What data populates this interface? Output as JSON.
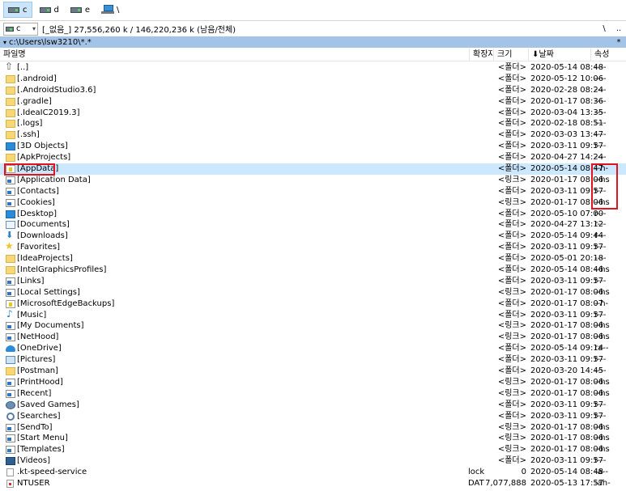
{
  "drives": [
    {
      "label": "c",
      "active": true
    },
    {
      "label": "d",
      "active": false
    },
    {
      "label": "e",
      "active": false
    },
    {
      "label": "\\",
      "active": false
    }
  ],
  "pathbar": {
    "drive_selector": "c",
    "free_info": "[_없음_]  27,556,260 k / 146,220,236 k (남음/전체)",
    "root_button": "\\",
    "parent_button": ".."
  },
  "current_path": {
    "path": "c:\\Users\\lsw3210\\*.*",
    "history_button": "*",
    "arrow_button": "▾"
  },
  "columns": {
    "name": "파일명",
    "ext": "확장자",
    "size": "크기",
    "date": "⬇날짜",
    "attr": "속성"
  },
  "files": [
    {
      "icon": "up",
      "name": "[..]",
      "ext": "",
      "size": "<폴더>",
      "date": "2020-05-14 08:48",
      "attr": "----"
    },
    {
      "icon": "folder",
      "name": "[.android]",
      "ext": "",
      "size": "<폴더>",
      "date": "2020-05-12 10:06",
      "attr": "----"
    },
    {
      "icon": "folder",
      "name": "[.AndroidStudio3.6]",
      "ext": "",
      "size": "<폴더>",
      "date": "2020-02-28 08:24",
      "attr": "----"
    },
    {
      "icon": "folder",
      "name": "[.gradle]",
      "ext": "",
      "size": "<폴더>",
      "date": "2020-01-17 08:36",
      "attr": "----"
    },
    {
      "icon": "folder",
      "name": "[.IdeaIC2019.3]",
      "ext": "",
      "size": "<폴더>",
      "date": "2020-03-04 13:35",
      "attr": "----"
    },
    {
      "icon": "folder",
      "name": "[.logs]",
      "ext": "",
      "size": "<폴더>",
      "date": "2020-02-18 08:51",
      "attr": "----"
    },
    {
      "icon": "folder",
      "name": "[.ssh]",
      "ext": "",
      "size": "<폴더>",
      "date": "2020-03-03 13:47",
      "attr": "----"
    },
    {
      "icon": "blue",
      "name": "[3D Objects]",
      "ext": "",
      "size": "<폴더>",
      "date": "2020-03-11 09:57",
      "attr": "r---"
    },
    {
      "icon": "folder",
      "name": "[ApkProjects]",
      "ext": "",
      "size": "<폴더>",
      "date": "2020-04-27 14:24",
      "attr": "----"
    },
    {
      "icon": "sys",
      "name": "[AppData]",
      "ext": "",
      "size": "<폴더>",
      "date": "2020-05-14 08:47",
      "attr": "--h-",
      "selected": true
    },
    {
      "icon": "link",
      "name": "[Application Data]",
      "ext": "",
      "size": "<링크>",
      "date": "2020-01-17 08:06",
      "attr": "--hs"
    },
    {
      "icon": "link",
      "name": "[Contacts]",
      "ext": "",
      "size": "<폴더>",
      "date": "2020-03-11 09:57",
      "attr": "r---"
    },
    {
      "icon": "link",
      "name": "[Cookies]",
      "ext": "",
      "size": "<링크>",
      "date": "2020-01-17 08:06",
      "attr": "--hs"
    },
    {
      "icon": "blue",
      "name": "[Desktop]",
      "ext": "",
      "size": "<폴더>",
      "date": "2020-05-10 07:00",
      "attr": "r---"
    },
    {
      "icon": "doc",
      "name": "[Documents]",
      "ext": "",
      "size": "<폴더>",
      "date": "2020-04-27 13:12",
      "attr": "r---"
    },
    {
      "icon": "down",
      "name": "[Downloads]",
      "ext": "",
      "size": "<폴더>",
      "date": "2020-05-14 09:44",
      "attr": "r---"
    },
    {
      "icon": "star",
      "name": "[Favorites]",
      "ext": "",
      "size": "<폴더>",
      "date": "2020-03-11 09:57",
      "attr": "r---"
    },
    {
      "icon": "folder",
      "name": "[IdeaProjects]",
      "ext": "",
      "size": "<폴더>",
      "date": "2020-05-01 20:18",
      "attr": "----"
    },
    {
      "icon": "folder",
      "name": "[IntelGraphicsProfiles]",
      "ext": "",
      "size": "<폴더>",
      "date": "2020-05-14 08:46",
      "attr": "--hs"
    },
    {
      "icon": "link",
      "name": "[Links]",
      "ext": "",
      "size": "<폴더>",
      "date": "2020-03-11 09:57",
      "attr": "r---"
    },
    {
      "icon": "link",
      "name": "[Local Settings]",
      "ext": "",
      "size": "<링크>",
      "date": "2020-01-17 08:06",
      "attr": "--hs"
    },
    {
      "icon": "sys",
      "name": "[MicrosoftEdgeBackups]",
      "ext": "",
      "size": "<폴더>",
      "date": "2020-01-17 08:07",
      "attr": "--h-"
    },
    {
      "icon": "music",
      "name": "[Music]",
      "ext": "",
      "size": "<폴더>",
      "date": "2020-03-11 09:57",
      "attr": "r---"
    },
    {
      "icon": "link",
      "name": "[My Documents]",
      "ext": "",
      "size": "<링크>",
      "date": "2020-01-17 08:06",
      "attr": "--hs"
    },
    {
      "icon": "link",
      "name": "[NetHood]",
      "ext": "",
      "size": "<링크>",
      "date": "2020-01-17 08:06",
      "attr": "--hs"
    },
    {
      "icon": "cloud",
      "name": "[OneDrive]",
      "ext": "",
      "size": "<폴더>",
      "date": "2020-05-14 09:14",
      "attr": "ra--"
    },
    {
      "icon": "pic",
      "name": "[Pictures]",
      "ext": "",
      "size": "<폴더>",
      "date": "2020-03-11 09:57",
      "attr": "r---"
    },
    {
      "icon": "folder",
      "name": "[Postman]",
      "ext": "",
      "size": "<폴더>",
      "date": "2020-03-20 14:45",
      "attr": "----"
    },
    {
      "icon": "link",
      "name": "[PrintHood]",
      "ext": "",
      "size": "<링크>",
      "date": "2020-01-17 08:06",
      "attr": "--hs"
    },
    {
      "icon": "link",
      "name": "[Recent]",
      "ext": "",
      "size": "<링크>",
      "date": "2020-01-17 08:06",
      "attr": "--hs"
    },
    {
      "icon": "game",
      "name": "[Saved Games]",
      "ext": "",
      "size": "<폴더>",
      "date": "2020-03-11 09:57",
      "attr": "r---"
    },
    {
      "icon": "search",
      "name": "[Searches]",
      "ext": "",
      "size": "<폴더>",
      "date": "2020-03-11 09:57",
      "attr": "r---"
    },
    {
      "icon": "link",
      "name": "[SendTo]",
      "ext": "",
      "size": "<링크>",
      "date": "2020-01-17 08:06",
      "attr": "--hs"
    },
    {
      "icon": "link",
      "name": "[Start Menu]",
      "ext": "",
      "size": "<링크>",
      "date": "2020-01-17 08:06",
      "attr": "--hs"
    },
    {
      "icon": "link",
      "name": "[Templates]",
      "ext": "",
      "size": "<링크>",
      "date": "2020-01-17 08:06",
      "attr": "--hs"
    },
    {
      "icon": "video",
      "name": "[Videos]",
      "ext": "",
      "size": "<폴더>",
      "date": "2020-03-11 09:57",
      "attr": "r---"
    },
    {
      "icon": "file",
      "name": ".kt-speed-service",
      "ext": "lock",
      "size": "0",
      "date": "2020-05-14 08:48",
      "attr": "-a--"
    },
    {
      "icon": "datfile",
      "name": "NTUSER",
      "ext": "DAT",
      "size": "7,077,888",
      "date": "2020-05-13 17:57",
      "attr": "-ah-"
    }
  ],
  "colors": {
    "path_bar": "#a3c3e7",
    "selection": "#cce8ff",
    "highlight_box": "#e0141e",
    "folder": "#f8d775"
  }
}
